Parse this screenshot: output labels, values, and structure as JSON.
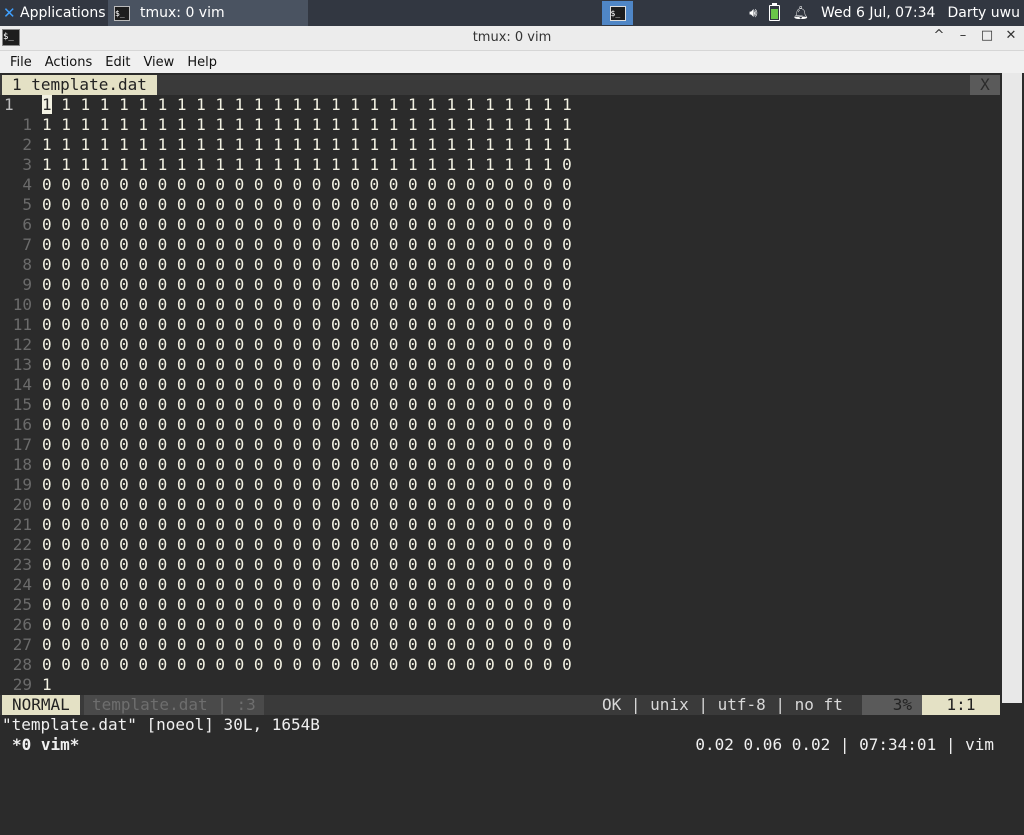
{
  "panel": {
    "apps_label": "Applications ☰",
    "task_label": "tmux: 0 vim",
    "volume_icon": "volume-icon",
    "battery_icon": "battery-icon",
    "bell_icon": "notification-bell-icon",
    "clock": "Wed  6 Jul, 07:34",
    "user": "Darty uwu"
  },
  "window": {
    "title": "tmux: 0 vim",
    "minimize": "–",
    "maximize": "□",
    "close": "✕",
    "collapse": "^"
  },
  "menu": [
    "File",
    "Actions",
    "Edit",
    "View",
    "Help"
  ],
  "vim": {
    "tab_label": "1 template.dat",
    "tab_close": "X",
    "lines": [
      {
        "n": "1",
        "text": "1 1 1 1 1 1 1 1 1 1 1 1 1 1 1 1 1 1 1 1 1 1 1 1 1 1 1 1"
      },
      {
        "n": "1",
        "text": "1 1 1 1 1 1 1 1 1 1 1 1 1 1 1 1 1 1 1 1 1 1 1 1 1 1 1 1"
      },
      {
        "n": "2",
        "text": "1 1 1 1 1 1 1 1 1 1 1 1 1 1 1 1 1 1 1 1 1 1 1 1 1 1 1 1"
      },
      {
        "n": "3",
        "text": "1 1 1 1 1 1 1 1 1 1 1 1 1 1 1 1 1 1 1 1 1 1 1 1 1 1 1 0"
      },
      {
        "n": "4",
        "text": "0 0 0 0 0 0 0 0 0 0 0 0 0 0 0 0 0 0 0 0 0 0 0 0 0 0 0 0"
      },
      {
        "n": "5",
        "text": "0 0 0 0 0 0 0 0 0 0 0 0 0 0 0 0 0 0 0 0 0 0 0 0 0 0 0 0"
      },
      {
        "n": "6",
        "text": "0 0 0 0 0 0 0 0 0 0 0 0 0 0 0 0 0 0 0 0 0 0 0 0 0 0 0 0"
      },
      {
        "n": "7",
        "text": "0 0 0 0 0 0 0 0 0 0 0 0 0 0 0 0 0 0 0 0 0 0 0 0 0 0 0 0"
      },
      {
        "n": "8",
        "text": "0 0 0 0 0 0 0 0 0 0 0 0 0 0 0 0 0 0 0 0 0 0 0 0 0 0 0 0"
      },
      {
        "n": "9",
        "text": "0 0 0 0 0 0 0 0 0 0 0 0 0 0 0 0 0 0 0 0 0 0 0 0 0 0 0 0"
      },
      {
        "n": "10",
        "text": "0 0 0 0 0 0 0 0 0 0 0 0 0 0 0 0 0 0 0 0 0 0 0 0 0 0 0 0"
      },
      {
        "n": "11",
        "text": "0 0 0 0 0 0 0 0 0 0 0 0 0 0 0 0 0 0 0 0 0 0 0 0 0 0 0 0"
      },
      {
        "n": "12",
        "text": "0 0 0 0 0 0 0 0 0 0 0 0 0 0 0 0 0 0 0 0 0 0 0 0 0 0 0 0"
      },
      {
        "n": "13",
        "text": "0 0 0 0 0 0 0 0 0 0 0 0 0 0 0 0 0 0 0 0 0 0 0 0 0 0 0 0"
      },
      {
        "n": "14",
        "text": "0 0 0 0 0 0 0 0 0 0 0 0 0 0 0 0 0 0 0 0 0 0 0 0 0 0 0 0"
      },
      {
        "n": "15",
        "text": "0 0 0 0 0 0 0 0 0 0 0 0 0 0 0 0 0 0 0 0 0 0 0 0 0 0 0 0"
      },
      {
        "n": "16",
        "text": "0 0 0 0 0 0 0 0 0 0 0 0 0 0 0 0 0 0 0 0 0 0 0 0 0 0 0 0"
      },
      {
        "n": "17",
        "text": "0 0 0 0 0 0 0 0 0 0 0 0 0 0 0 0 0 0 0 0 0 0 0 0 0 0 0 0"
      },
      {
        "n": "18",
        "text": "0 0 0 0 0 0 0 0 0 0 0 0 0 0 0 0 0 0 0 0 0 0 0 0 0 0 0 0"
      },
      {
        "n": "19",
        "text": "0 0 0 0 0 0 0 0 0 0 0 0 0 0 0 0 0 0 0 0 0 0 0 0 0 0 0 0"
      },
      {
        "n": "20",
        "text": "0 0 0 0 0 0 0 0 0 0 0 0 0 0 0 0 0 0 0 0 0 0 0 0 0 0 0 0"
      },
      {
        "n": "21",
        "text": "0 0 0 0 0 0 0 0 0 0 0 0 0 0 0 0 0 0 0 0 0 0 0 0 0 0 0 0"
      },
      {
        "n": "22",
        "text": "0 0 0 0 0 0 0 0 0 0 0 0 0 0 0 0 0 0 0 0 0 0 0 0 0 0 0 0"
      },
      {
        "n": "23",
        "text": "0 0 0 0 0 0 0 0 0 0 0 0 0 0 0 0 0 0 0 0 0 0 0 0 0 0 0 0"
      },
      {
        "n": "24",
        "text": "0 0 0 0 0 0 0 0 0 0 0 0 0 0 0 0 0 0 0 0 0 0 0 0 0 0 0 0"
      },
      {
        "n": "25",
        "text": "0 0 0 0 0 0 0 0 0 0 0 0 0 0 0 0 0 0 0 0 0 0 0 0 0 0 0 0"
      },
      {
        "n": "26",
        "text": "0 0 0 0 0 0 0 0 0 0 0 0 0 0 0 0 0 0 0 0 0 0 0 0 0 0 0 0"
      },
      {
        "n": "27",
        "text": "0 0 0 0 0 0 0 0 0 0 0 0 0 0 0 0 0 0 0 0 0 0 0 0 0 0 0 0"
      },
      {
        "n": "28",
        "text": "0 0 0 0 0 0 0 0 0 0 0 0 0 0 0 0 0 0 0 0 0 0 0 0 0 0 0 0"
      },
      {
        "n": "29",
        "text": "1"
      }
    ],
    "status": {
      "mode": "NORMAL",
      "file": "template.dat | :3",
      "info": "OK | unix | utf-8 | no ft",
      "percent": "3%",
      "position": "1:1"
    },
    "cmdline": "\"template.dat\" [noeol] 30L, 1654B"
  },
  "tmux": {
    "window": "*0 vim*",
    "right": "0.02 0.06 0.02 | 07:34:01 | vim"
  },
  "colors": {
    "terminal_bg": "#2b2b2b",
    "accent": "#e4e1c5",
    "panel_bg": "#323741",
    "workspace": "#4f86c6"
  }
}
